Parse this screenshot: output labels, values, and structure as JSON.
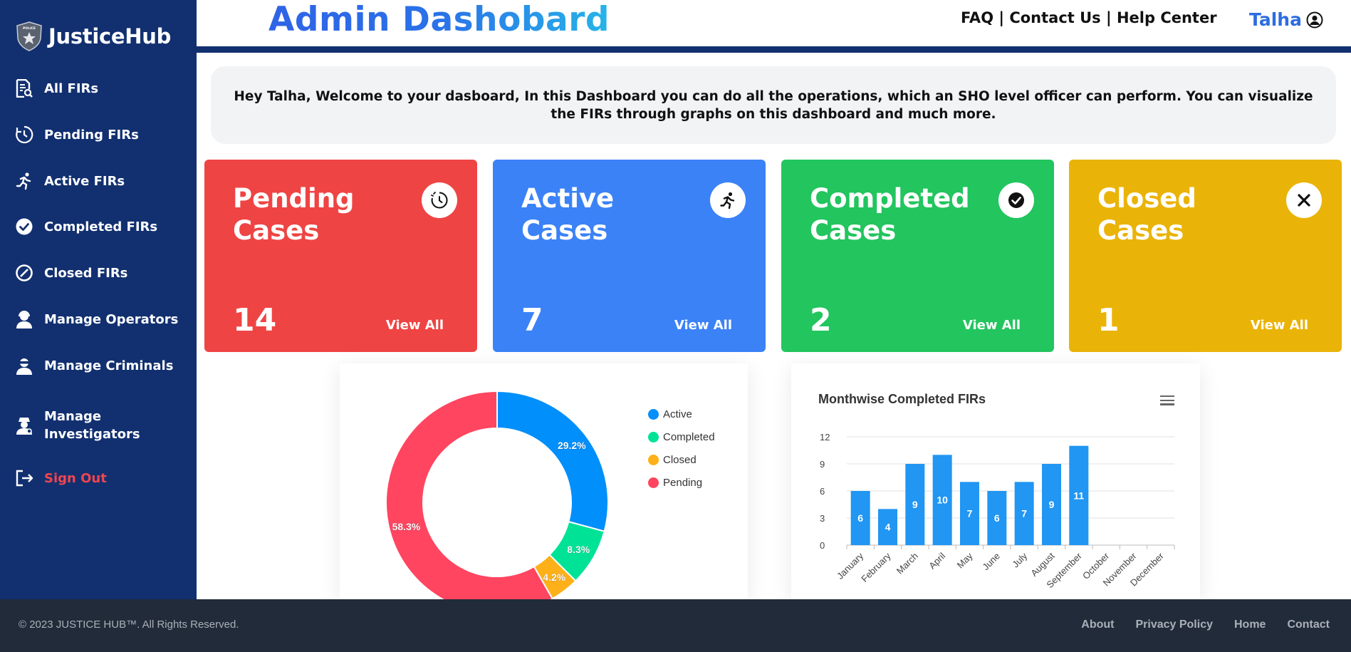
{
  "sidebar": {
    "brand": "JusticeHub",
    "badge_text": "POLICE",
    "items": [
      {
        "label": "All FIRs",
        "icon": "document-search-icon"
      },
      {
        "label": "Pending FIRs",
        "icon": "clock-history-icon"
      },
      {
        "label": "Active FIRs",
        "icon": "running-person-icon"
      },
      {
        "label": "Completed FIRs",
        "icon": "check-circle-icon"
      },
      {
        "label": "Closed FIRs",
        "icon": "ban-icon"
      },
      {
        "label": "Manage Operators",
        "icon": "user-headset-icon"
      },
      {
        "label": "Manage Criminals",
        "icon": "user-masked-icon"
      },
      {
        "label": "Manage Investigators",
        "icon": "user-detective-icon"
      },
      {
        "label": "Sign Out",
        "icon": "sign-out-icon"
      }
    ]
  },
  "header": {
    "title": "Admin Dashobard",
    "links": "FAQ | Contact Us | Help Center",
    "user": "Talha"
  },
  "welcome": "Hey Talha, Welcome to your dasboard, In this Dashboard you can do all the operations, which an SHO level officer can perform. You can visualize the FIRs through graphs on this dashboard and much more.",
  "cards": [
    {
      "title": "Pending Cases",
      "count": "14",
      "view": "View All",
      "color": "#ef4444",
      "icon": "clock-history-icon"
    },
    {
      "title": "Active Cases",
      "count": "7",
      "view": "View All",
      "color": "#3b82f6",
      "icon": "running-person-icon"
    },
    {
      "title": "Completed Cases",
      "count": "2",
      "view": "View All",
      "color": "#22c55e",
      "icon": "check-circle-icon"
    },
    {
      "title": "Closed Cases",
      "count": "1",
      "view": "View All",
      "color": "#eab308",
      "icon": "close-x-icon"
    }
  ],
  "chart_data": [
    {
      "type": "pie",
      "labels": [
        "Active",
        "Completed",
        "Closed",
        "Pending"
      ],
      "values": [
        29.2,
        8.3,
        4.2,
        58.3
      ],
      "data_labels": [
        "29.2%",
        "8.3%",
        "4.2%",
        "58.3%"
      ],
      "colors": [
        "#008ffb",
        "#00e396",
        "#feb019",
        "#ff4560"
      ],
      "legend": "right"
    },
    {
      "type": "bar",
      "title": "Monthwise Completed FIRs",
      "categories": [
        "January",
        "February",
        "March",
        "April",
        "May",
        "June",
        "July",
        "August",
        "September",
        "October",
        "November",
        "December"
      ],
      "values": [
        6,
        4,
        9,
        10,
        7,
        6,
        7,
        9,
        11,
        0,
        0,
        0
      ],
      "data_labels": [
        "6",
        "4",
        "9",
        "10",
        "7",
        "6",
        "7",
        "9",
        "11",
        "",
        "",
        ""
      ],
      "yticks": [
        "0",
        "3",
        "6",
        "9",
        "12"
      ],
      "ylim": [
        0,
        12
      ],
      "grid": true,
      "color": "#2196f3"
    }
  ],
  "footer": {
    "copyright": "© 2023 JUSTICE HUB™. All Rights Reserved.",
    "links": [
      "About",
      "Privacy Policy",
      "Home",
      "Contact"
    ]
  }
}
